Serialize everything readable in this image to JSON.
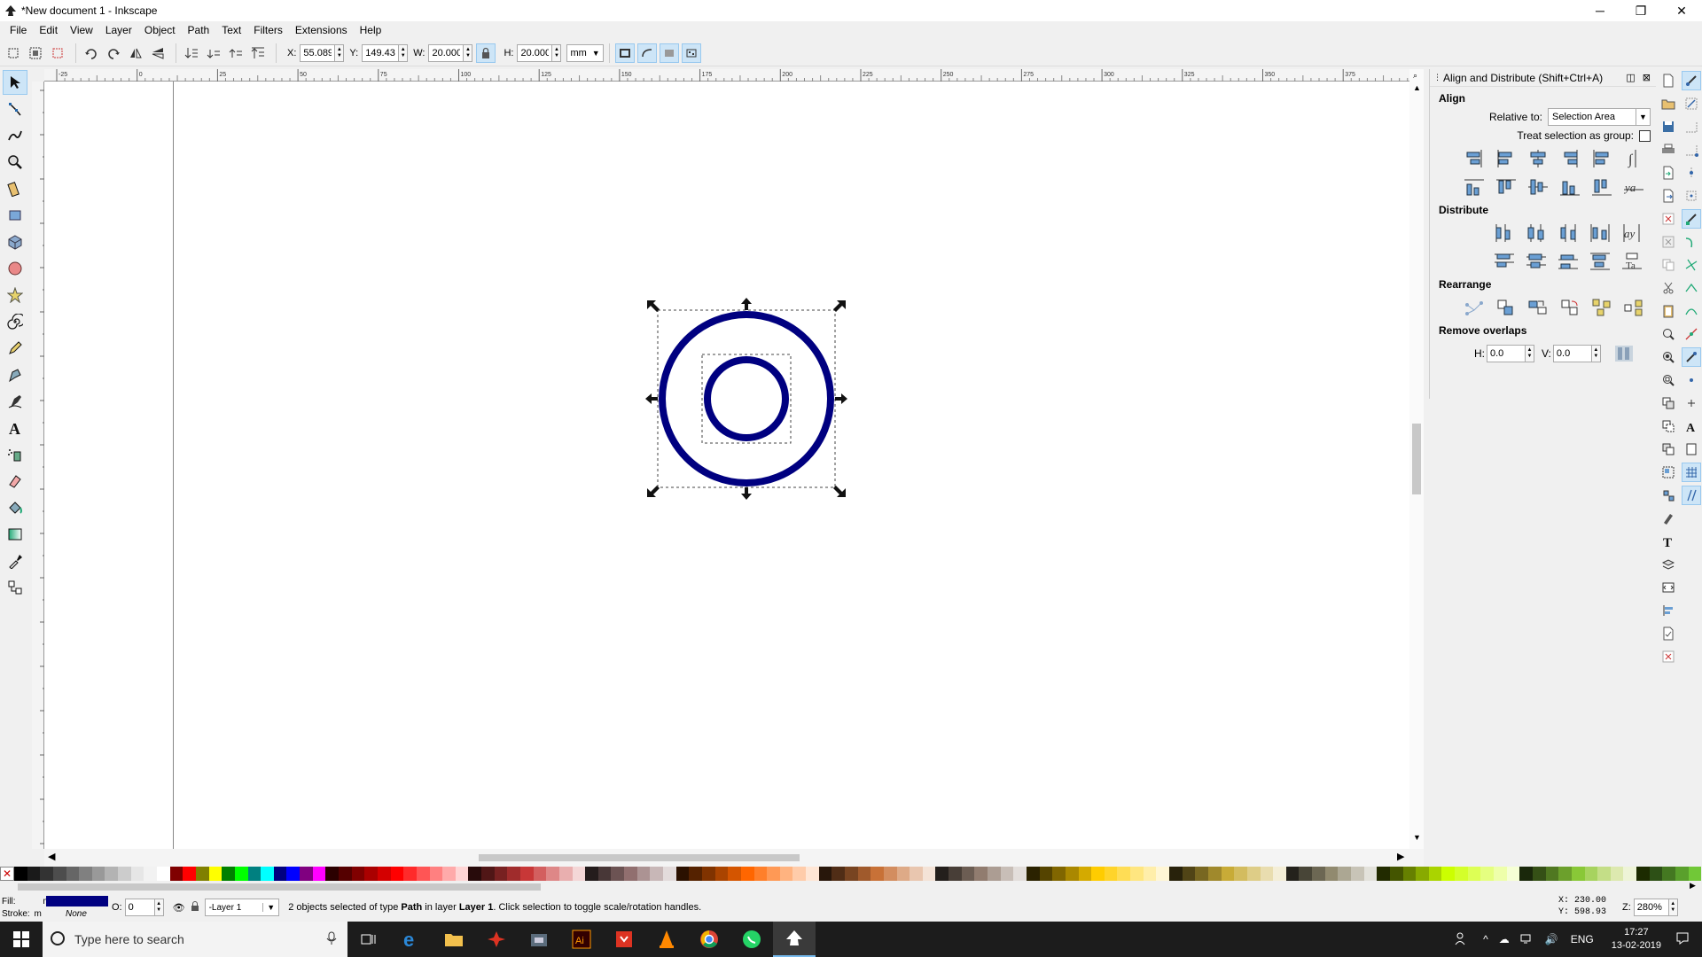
{
  "window": {
    "title": "*New document 1 - Inkscape",
    "minimize": "─",
    "maximize": "❐",
    "close": "✕"
  },
  "menu": [
    "File",
    "Edit",
    "View",
    "Layer",
    "Object",
    "Path",
    "Text",
    "Filters",
    "Extensions",
    "Help"
  ],
  "controls": {
    "x_label": "X:",
    "x_value": "55.089",
    "y_label": "Y:",
    "y_value": "149.432",
    "w_label": "W:",
    "w_value": "20.000",
    "h_label": "H:",
    "h_value": "20.000",
    "unit": "mm"
  },
  "ruler": {
    "top_ticks": [
      "-25",
      "0",
      "25",
      "50",
      "75",
      "100",
      "125",
      "150",
      "175",
      "200",
      "225",
      "250",
      "275",
      "300",
      "325",
      "350",
      "375"
    ]
  },
  "dock": {
    "title": "Align and Distribute (Shift+Ctrl+A)",
    "align_title": "Align",
    "relative_label": "Relative to:",
    "relative_value": "Selection Area",
    "group_label": "Treat selection as group:",
    "distribute_title": "Distribute",
    "rearrange_title": "Rearrange",
    "overlaps_title": "Remove overlaps",
    "h_label": "H:",
    "h_value": "0.0",
    "v_label": "V:",
    "v_value": "0.0"
  },
  "status": {
    "fill_label": "Fill:",
    "fill_marker": "m",
    "stroke_label": "Stroke:",
    "stroke_marker": "m",
    "stroke_value": "None",
    "opacity_label": "O:",
    "opacity_value": "0",
    "layer": "-Layer 1",
    "message_prefix": "2 objects selected of type ",
    "message_type": "Path",
    "message_mid": " in layer ",
    "message_layer": "Layer 1",
    "message_suffix": ". Click selection to toggle scale/rotation handles.",
    "x_coord": "X:  230.00",
    "y_coord": "Y:  598.93",
    "zoom_label": "Z:",
    "zoom_value": "280%"
  },
  "taskbar": {
    "search_placeholder": "Type here to search",
    "lang": "ENG",
    "time": "17:27",
    "date": "13-02-2019"
  },
  "colors": {
    "stroke": "#000080",
    "accent": "#cde5f7"
  }
}
